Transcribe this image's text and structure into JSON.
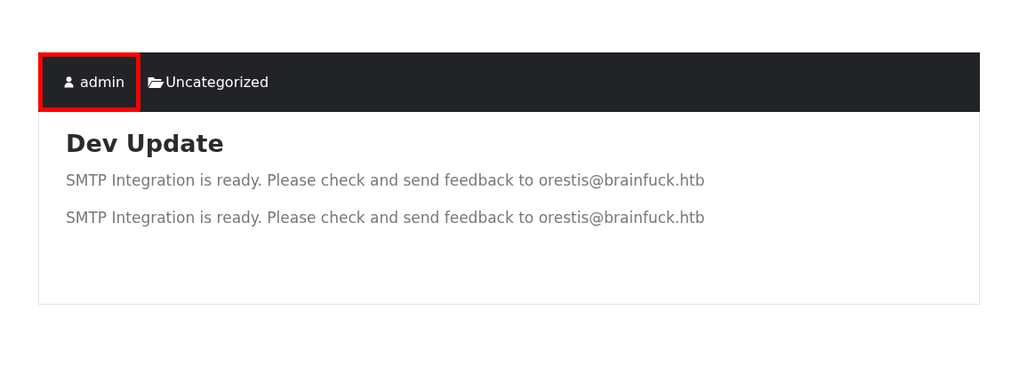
{
  "post": {
    "meta": [
      {
        "kind": "author",
        "label": "admin",
        "highlighted": true
      },
      {
        "kind": "category",
        "label": "Uncategorized",
        "highlighted": false
      }
    ],
    "title": "Dev Update",
    "paragraphs": [
      "SMTP Integration is ready. Please check and send feedback to orestis@brainfuck.htb",
      "SMTP Integration is ready. Please check and send feedback to orestis@brainfuck.htb"
    ]
  }
}
